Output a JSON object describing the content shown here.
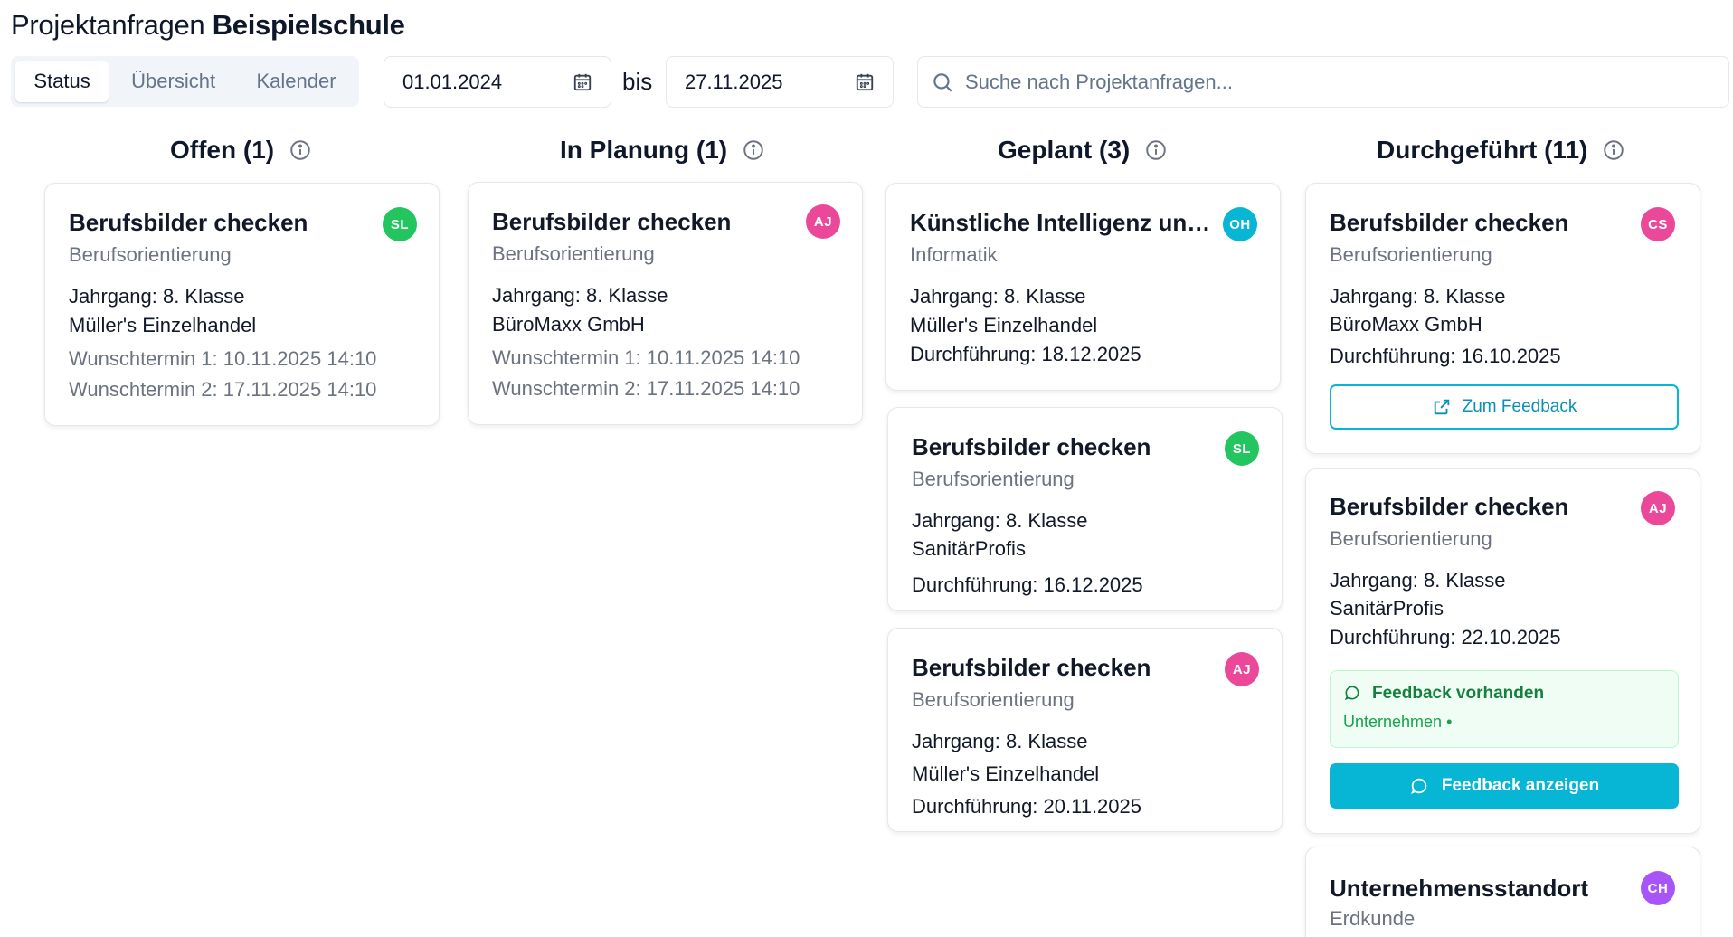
{
  "page": {
    "title_prefix": "Projektanfragen",
    "title_school": "Beispielschule"
  },
  "tabs": [
    {
      "label": "Status",
      "active": true
    },
    {
      "label": "Übersicht",
      "active": false
    },
    {
      "label": "Kalender",
      "active": false
    }
  ],
  "date_range": {
    "from": "01.01.2024",
    "separator": "bis",
    "to": "27.11.2025"
  },
  "search": {
    "placeholder": "Suche nach Projektanfragen..."
  },
  "columns": [
    {
      "name": "Offen",
      "count": "(1)"
    },
    {
      "name": "In Planung",
      "count": "(1)"
    },
    {
      "name": "Geplant",
      "count": "(3)"
    },
    {
      "name": "Durchgeführt",
      "count": "(11)"
    }
  ],
  "cards": {
    "offen_1": {
      "title": "Berufsbilder checken",
      "subject": "Berufsorientierung",
      "grade": "Jahrgang: 8. Klasse",
      "company": "Müller's Einzelhandel",
      "wish1": "Wunschtermin 1: 10.11.2025 14:10",
      "wish2": "Wunschtermin 2: 17.11.2025 14:10",
      "avatar": "SL",
      "avatar_color": "#22c55e"
    },
    "planung_1": {
      "title": "Berufsbilder checken",
      "subject": "Berufsorientierung",
      "grade": "Jahrgang: 8. Klasse",
      "company": "BüroMaxx GmbH",
      "wish1": "Wunschtermin 1: 10.11.2025 14:10",
      "wish2": "Wunschtermin 2: 17.11.2025 14:10",
      "avatar": "AJ",
      "avatar_color": "#ec4899"
    },
    "geplant_1": {
      "title": "Künstliche Intelligenz und...",
      "subject": "Informatik",
      "grade": "Jahrgang: 8. Klasse",
      "company": "Müller's Einzelhandel",
      "date": "Durchführung: 18.12.2025",
      "avatar": "OH",
      "avatar_color": "#06b6d4"
    },
    "geplant_2": {
      "title": "Berufsbilder checken",
      "subject": "Berufsorientierung",
      "grade": "Jahrgang: 8. Klasse",
      "company": "SanitärProfis",
      "date": "Durchführung: 16.12.2025",
      "avatar": "SL",
      "avatar_color": "#22c55e"
    },
    "geplant_3": {
      "title": "Berufsbilder checken",
      "subject": "Berufsorientierung",
      "grade": "Jahrgang: 8. Klasse",
      "company": "Müller's Einzelhandel",
      "date": "Durchführung: 20.11.2025",
      "avatar": "AJ",
      "avatar_color": "#ec4899"
    },
    "durch_1": {
      "title": "Berufsbilder checken",
      "subject": "Berufsorientierung",
      "grade": "Jahrgang: 8. Klasse",
      "company": "BüroMaxx GmbH",
      "date": "Durchführung: 16.10.2025",
      "button": "Zum Feedback",
      "avatar": "CS",
      "avatar_color": "#ec4899"
    },
    "durch_2": {
      "title": "Berufsbilder checken",
      "subject": "Berufsorientierung",
      "grade": "Jahrgang: 8. Klasse",
      "company": "SanitärProfis",
      "date": "Durchführung: 22.10.2025",
      "feedback_title": "Feedback vorhanden",
      "feedback_sub": "Unternehmen •",
      "button": "Feedback anzeigen",
      "avatar": "AJ",
      "avatar_color": "#ec4899"
    },
    "durch_3": {
      "title": "Unternehmensstandort",
      "subject": "Erdkunde",
      "avatar": "CH",
      "avatar_color": "#a855f7"
    }
  },
  "icons": {
    "calendar": "calendar-icon",
    "search": "search-icon",
    "info": "info-icon",
    "external": "external-link-icon",
    "chat": "chat-bubble-icon"
  },
  "colors": {
    "accent": "#06b6d4",
    "success_bg": "#f0fdf4",
    "success_text": "#15803d"
  }
}
